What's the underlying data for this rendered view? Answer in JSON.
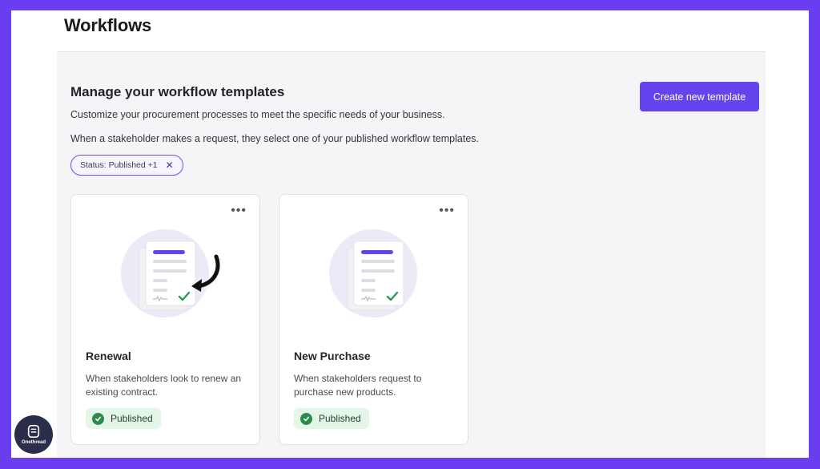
{
  "header": {
    "title": "Workflows"
  },
  "main": {
    "section_title": "Manage your workflow templates",
    "description_1": "Customize your procurement processes to meet the specific needs of your business.",
    "description_2": "When a stakeholder makes a request, they select one of your published workflow templates.",
    "create_button": "Create new template",
    "filter": {
      "label": "Status: Published +1",
      "close_icon": "close-icon",
      "close_glyph": "✕"
    },
    "more_glyph": "•••",
    "templates": [
      {
        "name": "Renewal",
        "description": "When stakeholders look to renew an existing contract.",
        "status": "Published",
        "icon": "renewal-document-illustration"
      },
      {
        "name": "New Purchase",
        "description": "When stakeholders request to purchase new products.",
        "status": "Published",
        "icon": "purchase-document-illustration"
      }
    ]
  },
  "watermark": {
    "brand": "Onethread"
  },
  "colors": {
    "accent": "#6543ee",
    "frame": "#6a3df0",
    "published_bg": "#e4f6e8",
    "published_icon": "#2c8a4a"
  }
}
